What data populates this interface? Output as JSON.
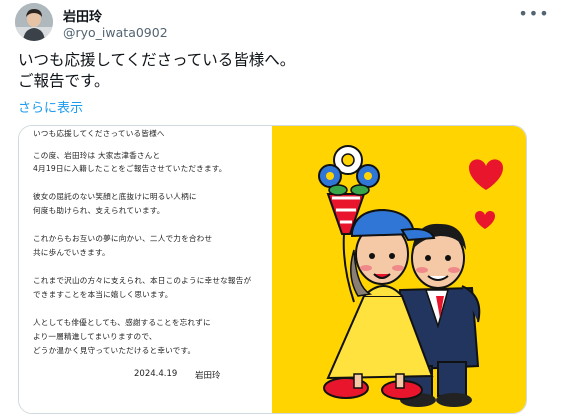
{
  "user": {
    "name": "岩田玲",
    "handle": "@ryo_iwata0902"
  },
  "toolbar": {
    "more_label": "•••"
  },
  "tweet": {
    "lines": [
      "いつも応援してくださっている皆様へ。",
      "ご報告です。"
    ],
    "show_more": "さらに表示"
  },
  "letter": {
    "lines": [
      "いつも応援してくださっている皆様へ",
      "この度、岩田玲は 大家志津香さんと",
      "4月19日に入籍したことをご報告させていただきます。",
      "彼女の屈託のない笑顔と底抜けに明るい人柄に",
      "何度も助けられ、支えられています。",
      "これからもお互いの夢に向かい、二人で力を合わせ",
      "共に歩んでいきます。",
      "これまで沢山の方々に支えられ、本日このように幸せな報告が",
      "できますことを本当に嬉しく思います。",
      "人としても俳優としても、感謝することを忘れずに",
      "より一層精進してまいりますので、",
      "どうか温かく見守っていただけると幸いです。"
    ],
    "date": "2024.4.19",
    "signature": "岩田玲"
  },
  "colors": {
    "accent": "#1d9bf0",
    "art_background": "#ffd400",
    "heart": "#e8152c",
    "text_secondary": "#536471"
  },
  "icons": [
    "more-icon",
    "avatar-image",
    "bouquet-illustration",
    "heart-icon"
  ]
}
